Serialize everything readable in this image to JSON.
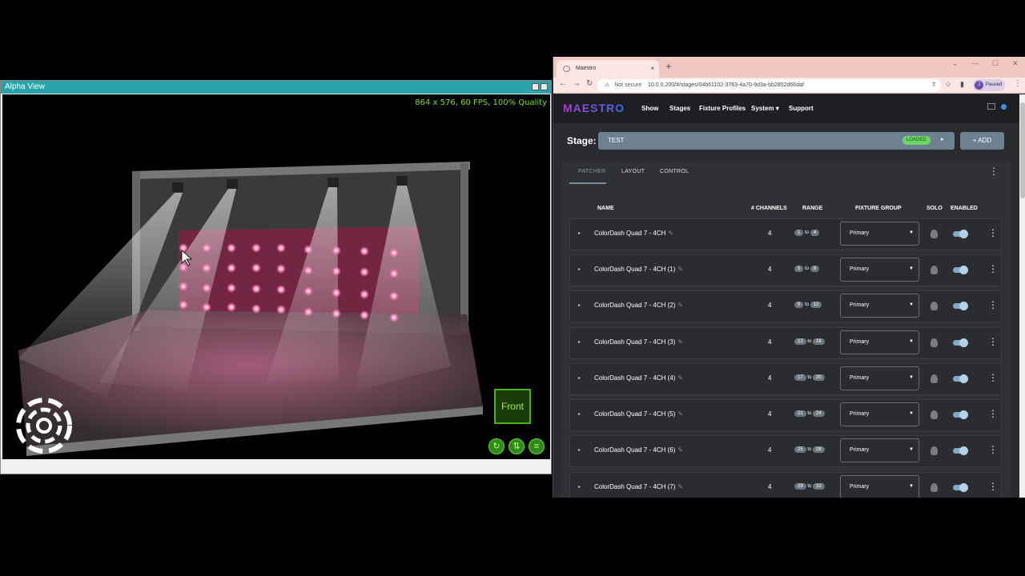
{
  "viz": {
    "title": "Alpha View",
    "fps_text": "864 x 576, 60 FPS, 100% Quality",
    "front_label": "Front"
  },
  "browser": {
    "tab_title": "Maestro",
    "tab_close": "×",
    "new_tab": "+",
    "not_secure": "Not secure",
    "url": "10.0.0.200/#/stages/04b61102-3763-4a70-9d3a-bb2852d66daf",
    "profile_initial": "J",
    "profile_status": "Paused"
  },
  "app": {
    "logo": "MAESTRO",
    "nav": [
      "Show",
      "Stages",
      "Fixture Profiles",
      "System",
      "Support"
    ],
    "system_caret": "▾",
    "stage_label": "Stage:",
    "stage_name": "TEST",
    "loaded_badge": "LOADED",
    "add_label": "+ ADD"
  },
  "panel": {
    "tabs": [
      "PATCHER",
      "LAYOUT",
      "CONTROL"
    ],
    "columns": {
      "name": "NAME",
      "channels": "# CHANNELS",
      "range": "RANGE",
      "group": "FIXTURE GROUP",
      "solo": "SOLO",
      "enabled": "ENABLED"
    },
    "range_sep": "to",
    "rows": [
      {
        "name": "ColorDash Quad 7 - 4CH",
        "channels": "4",
        "from": "1",
        "to": "4",
        "group": "Primary"
      },
      {
        "name": "ColorDash Quad 7 - 4CH (1)",
        "channels": "4",
        "from": "5",
        "to": "8",
        "group": "Primary"
      },
      {
        "name": "ColorDash Quad 7 - 4CH (2)",
        "channels": "4",
        "from": "9",
        "to": "12",
        "group": "Primary"
      },
      {
        "name": "ColorDash Quad 7 - 4CH (3)",
        "channels": "4",
        "from": "13",
        "to": "16",
        "group": "Primary"
      },
      {
        "name": "ColorDash Quad 7 - 4CH (4)",
        "channels": "4",
        "from": "17",
        "to": "20",
        "group": "Primary"
      },
      {
        "name": "ColorDash Quad 7 - 4CH (5)",
        "channels": "4",
        "from": "21",
        "to": "24",
        "group": "Primary"
      },
      {
        "name": "ColorDash Quad 7 - 4CH (6)",
        "channels": "4",
        "from": "25",
        "to": "28",
        "group": "Primary"
      },
      {
        "name": "ColorDash Quad 7 - 4CH (7)",
        "channels": "4",
        "from": "29",
        "to": "32",
        "group": "Primary"
      }
    ]
  },
  "colors": {
    "viz_titlebar": "#2aa3ab",
    "fps_green": "#7cdd1c",
    "stage_bar": "#6d8191",
    "loaded_green": "#6ed466",
    "led_pink": "#ff6fae"
  }
}
